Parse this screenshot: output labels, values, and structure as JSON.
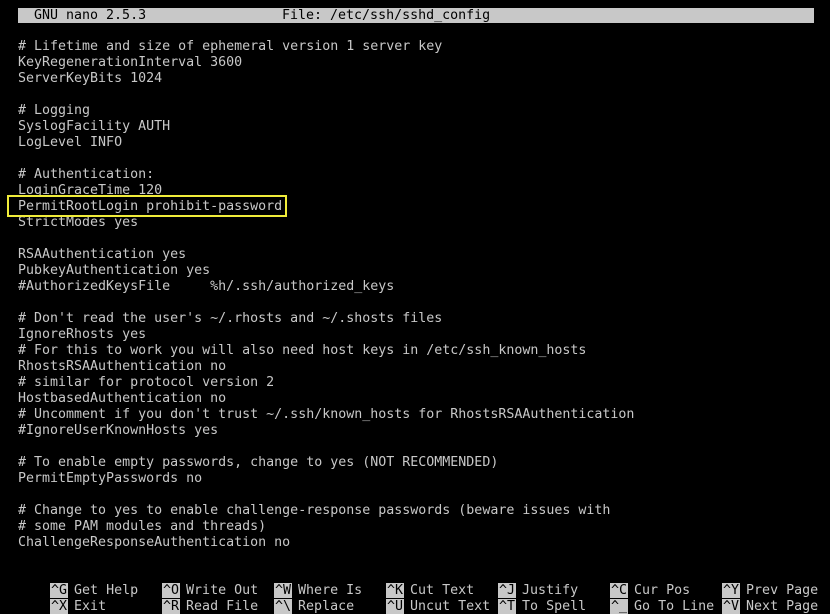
{
  "title_bar": {
    "app": "GNU nano 2.5.3",
    "file": "File: /etc/ssh/sshd_config"
  },
  "editor_lines": [
    "# Lifetime and size of ephemeral version 1 server key",
    "KeyRegenerationInterval 3600",
    "ServerKeyBits 1024",
    "",
    "# Logging",
    "SyslogFacility AUTH",
    "LogLevel INFO",
    "",
    "# Authentication:",
    "LoginGraceTime 120",
    "PermitRootLogin prohibit-password",
    "StrictModes yes",
    "",
    "RSAAuthentication yes",
    "PubkeyAuthentication yes",
    "#AuthorizedKeysFile     %h/.ssh/authorized_keys",
    "",
    "# Don't read the user's ~/.rhosts and ~/.shosts files",
    "IgnoreRhosts yes",
    "# For this to work you will also need host keys in /etc/ssh_known_hosts",
    "RhostsRSAAuthentication no",
    "# similar for protocol version 2",
    "HostbasedAuthentication no",
    "# Uncomment if you don't trust ~/.ssh/known_hosts for RhostsRSAAuthentication",
    "#IgnoreUserKnownHosts yes",
    "",
    "# To enable empty passwords, change to yes (NOT RECOMMENDED)",
    "PermitEmptyPasswords no",
    "",
    "# Change to yes to enable challenge-response passwords (beware issues with",
    "# some PAM modules and threads)",
    "ChallengeResponseAuthentication no"
  ],
  "highlight": {
    "color": "#f0ec3a"
  },
  "shortcuts": [
    {
      "key": "^G",
      "label": "Get Help"
    },
    {
      "key": "^O",
      "label": "Write Out"
    },
    {
      "key": "^W",
      "label": "Where Is"
    },
    {
      "key": "^K",
      "label": "Cut Text"
    },
    {
      "key": "^J",
      "label": "Justify"
    },
    {
      "key": "^C",
      "label": "Cur Pos"
    },
    {
      "key": "^Y",
      "label": "Prev Page"
    },
    {
      "key": "^X",
      "label": "Exit"
    },
    {
      "key": "^R",
      "label": "Read File"
    },
    {
      "key": "^\\",
      "label": "Replace"
    },
    {
      "key": "^U",
      "label": "Uncut Text"
    },
    {
      "key": "^T",
      "label": "To Spell"
    },
    {
      "key": "^_",
      "label": "Go To Line"
    },
    {
      "key": "^V",
      "label": "Next Page"
    }
  ]
}
